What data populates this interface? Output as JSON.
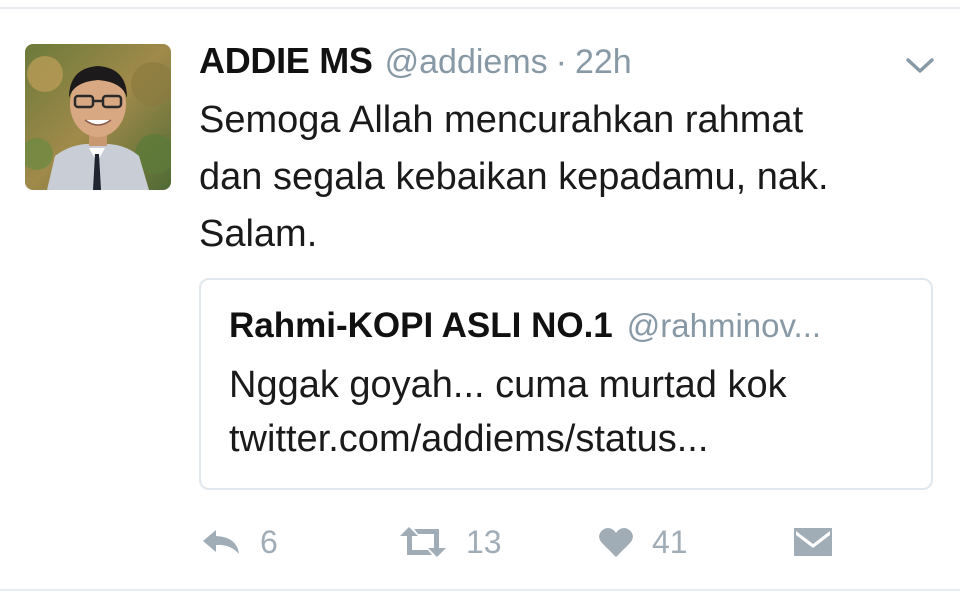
{
  "tweet": {
    "author_name": "ADDIE MS",
    "author_handle": "@addiems",
    "separator": "·",
    "time": "22h",
    "text_lines": [
      "Semoga Allah mencurahkan rahmat",
      "dan segala kebaikan kepadamu, nak.",
      "Salam."
    ],
    "menu_icon": "chevron-down-icon"
  },
  "quoted_tweet": {
    "author_name": "Rahmi-KOPI ASLI NO.1",
    "author_handle": "@rahminov...",
    "text_lines": [
      "Nggak goyah... cuma murtad kok",
      "twitter.com/addiems/status..."
    ]
  },
  "actions": {
    "reply": {
      "icon": "reply-icon",
      "count": "6"
    },
    "retweet": {
      "icon": "retweet-icon",
      "count": "13"
    },
    "like": {
      "icon": "heart-icon",
      "count": "41"
    },
    "message": {
      "icon": "envelope-icon"
    }
  },
  "colors": {
    "text_primary": "#1a1a1a",
    "text_secondary": "#8899a6",
    "icon_gray": "#a0adb7",
    "border": "#e1e8ed"
  }
}
